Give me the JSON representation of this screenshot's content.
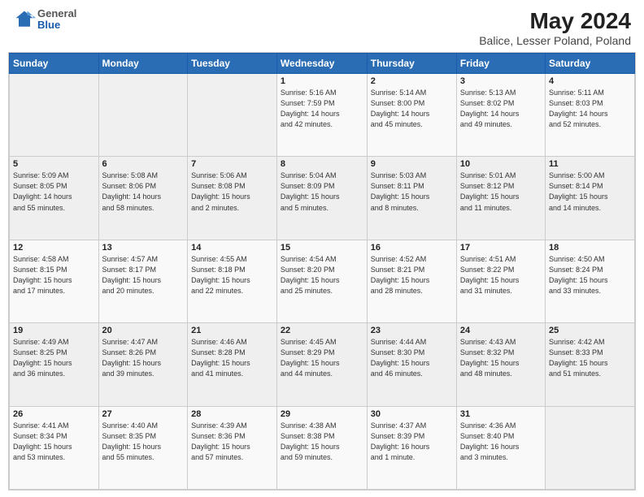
{
  "header": {
    "logo_general": "General",
    "logo_blue": "Blue",
    "title": "May 2024",
    "location": "Balice, Lesser Poland, Poland"
  },
  "days_of_week": [
    "Sunday",
    "Monday",
    "Tuesday",
    "Wednesday",
    "Thursday",
    "Friday",
    "Saturday"
  ],
  "weeks": [
    [
      {
        "day": "",
        "info": ""
      },
      {
        "day": "",
        "info": ""
      },
      {
        "day": "",
        "info": ""
      },
      {
        "day": "1",
        "info": "Sunrise: 5:16 AM\nSunset: 7:59 PM\nDaylight: 14 hours\nand 42 minutes."
      },
      {
        "day": "2",
        "info": "Sunrise: 5:14 AM\nSunset: 8:00 PM\nDaylight: 14 hours\nand 45 minutes."
      },
      {
        "day": "3",
        "info": "Sunrise: 5:13 AM\nSunset: 8:02 PM\nDaylight: 14 hours\nand 49 minutes."
      },
      {
        "day": "4",
        "info": "Sunrise: 5:11 AM\nSunset: 8:03 PM\nDaylight: 14 hours\nand 52 minutes."
      }
    ],
    [
      {
        "day": "5",
        "info": "Sunrise: 5:09 AM\nSunset: 8:05 PM\nDaylight: 14 hours\nand 55 minutes."
      },
      {
        "day": "6",
        "info": "Sunrise: 5:08 AM\nSunset: 8:06 PM\nDaylight: 14 hours\nand 58 minutes."
      },
      {
        "day": "7",
        "info": "Sunrise: 5:06 AM\nSunset: 8:08 PM\nDaylight: 15 hours\nand 2 minutes."
      },
      {
        "day": "8",
        "info": "Sunrise: 5:04 AM\nSunset: 8:09 PM\nDaylight: 15 hours\nand 5 minutes."
      },
      {
        "day": "9",
        "info": "Sunrise: 5:03 AM\nSunset: 8:11 PM\nDaylight: 15 hours\nand 8 minutes."
      },
      {
        "day": "10",
        "info": "Sunrise: 5:01 AM\nSunset: 8:12 PM\nDaylight: 15 hours\nand 11 minutes."
      },
      {
        "day": "11",
        "info": "Sunrise: 5:00 AM\nSunset: 8:14 PM\nDaylight: 15 hours\nand 14 minutes."
      }
    ],
    [
      {
        "day": "12",
        "info": "Sunrise: 4:58 AM\nSunset: 8:15 PM\nDaylight: 15 hours\nand 17 minutes."
      },
      {
        "day": "13",
        "info": "Sunrise: 4:57 AM\nSunset: 8:17 PM\nDaylight: 15 hours\nand 20 minutes."
      },
      {
        "day": "14",
        "info": "Sunrise: 4:55 AM\nSunset: 8:18 PM\nDaylight: 15 hours\nand 22 minutes."
      },
      {
        "day": "15",
        "info": "Sunrise: 4:54 AM\nSunset: 8:20 PM\nDaylight: 15 hours\nand 25 minutes."
      },
      {
        "day": "16",
        "info": "Sunrise: 4:52 AM\nSunset: 8:21 PM\nDaylight: 15 hours\nand 28 minutes."
      },
      {
        "day": "17",
        "info": "Sunrise: 4:51 AM\nSunset: 8:22 PM\nDaylight: 15 hours\nand 31 minutes."
      },
      {
        "day": "18",
        "info": "Sunrise: 4:50 AM\nSunset: 8:24 PM\nDaylight: 15 hours\nand 33 minutes."
      }
    ],
    [
      {
        "day": "19",
        "info": "Sunrise: 4:49 AM\nSunset: 8:25 PM\nDaylight: 15 hours\nand 36 minutes."
      },
      {
        "day": "20",
        "info": "Sunrise: 4:47 AM\nSunset: 8:26 PM\nDaylight: 15 hours\nand 39 minutes."
      },
      {
        "day": "21",
        "info": "Sunrise: 4:46 AM\nSunset: 8:28 PM\nDaylight: 15 hours\nand 41 minutes."
      },
      {
        "day": "22",
        "info": "Sunrise: 4:45 AM\nSunset: 8:29 PM\nDaylight: 15 hours\nand 44 minutes."
      },
      {
        "day": "23",
        "info": "Sunrise: 4:44 AM\nSunset: 8:30 PM\nDaylight: 15 hours\nand 46 minutes."
      },
      {
        "day": "24",
        "info": "Sunrise: 4:43 AM\nSunset: 8:32 PM\nDaylight: 15 hours\nand 48 minutes."
      },
      {
        "day": "25",
        "info": "Sunrise: 4:42 AM\nSunset: 8:33 PM\nDaylight: 15 hours\nand 51 minutes."
      }
    ],
    [
      {
        "day": "26",
        "info": "Sunrise: 4:41 AM\nSunset: 8:34 PM\nDaylight: 15 hours\nand 53 minutes."
      },
      {
        "day": "27",
        "info": "Sunrise: 4:40 AM\nSunset: 8:35 PM\nDaylight: 15 hours\nand 55 minutes."
      },
      {
        "day": "28",
        "info": "Sunrise: 4:39 AM\nSunset: 8:36 PM\nDaylight: 15 hours\nand 57 minutes."
      },
      {
        "day": "29",
        "info": "Sunrise: 4:38 AM\nSunset: 8:38 PM\nDaylight: 15 hours\nand 59 minutes."
      },
      {
        "day": "30",
        "info": "Sunrise: 4:37 AM\nSunset: 8:39 PM\nDaylight: 16 hours\nand 1 minute."
      },
      {
        "day": "31",
        "info": "Sunrise: 4:36 AM\nSunset: 8:40 PM\nDaylight: 16 hours\nand 3 minutes."
      },
      {
        "day": "",
        "info": ""
      }
    ]
  ]
}
